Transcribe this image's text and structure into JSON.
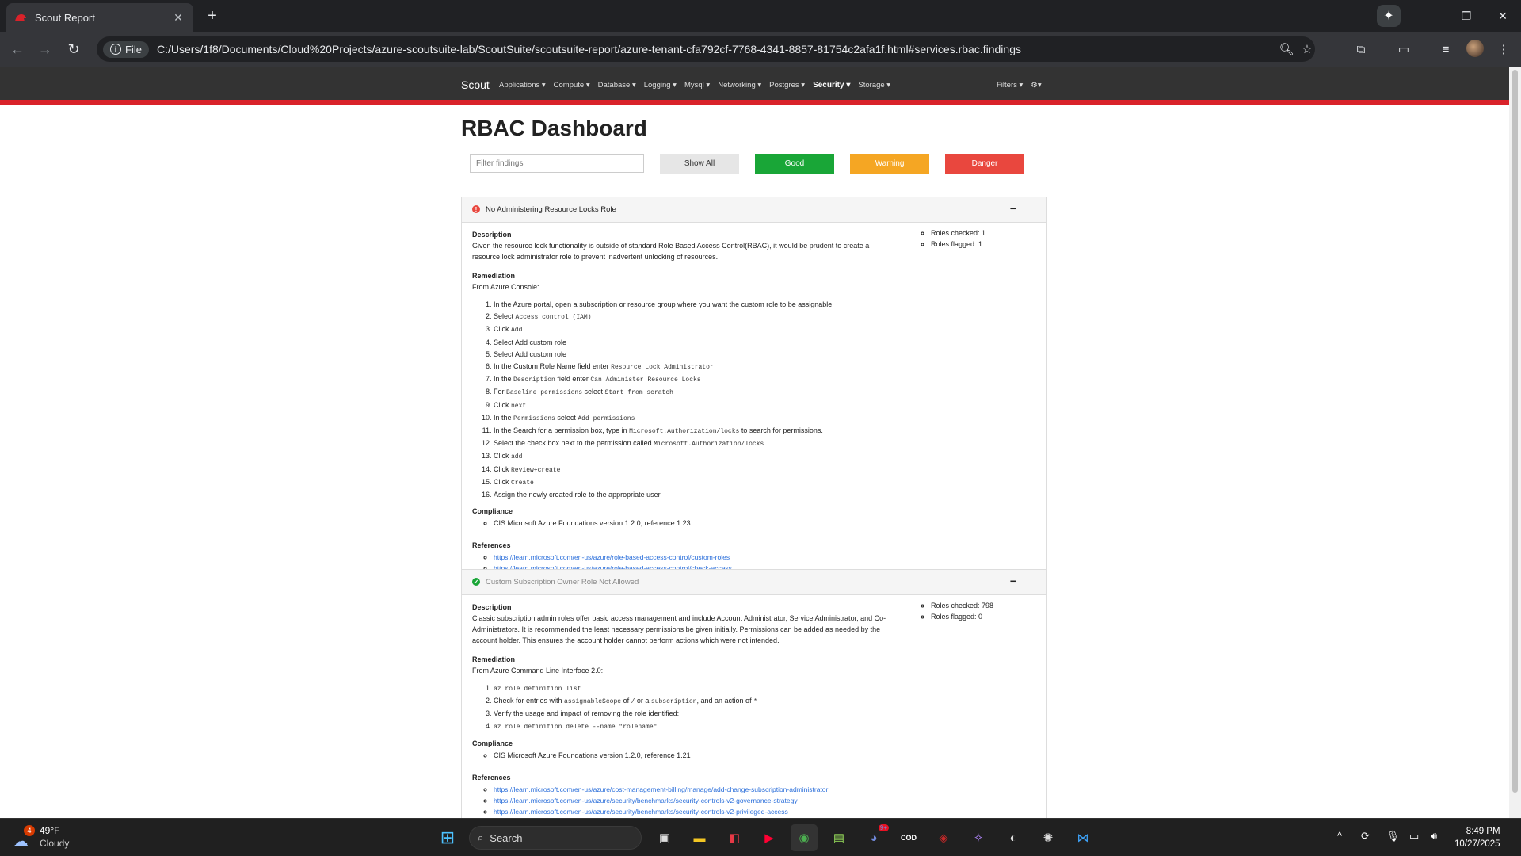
{
  "browser": {
    "tab_title": "Scout Report",
    "new_tab": "+",
    "file_chip": "File",
    "url": "C:/Users/1f8/Documents/Cloud%20Projects/azure-scoutsuite-lab/ScoutSuite/scoutsuite-report/azure-tenant-cfa792cf-7768-4341-8857-81754c2afa1f.html#services.rbac.findings"
  },
  "scout_nav": {
    "brand": "Scout",
    "menu": [
      "Applications",
      "Compute",
      "Database",
      "Logging",
      "Mysql",
      "Networking",
      "Postgres",
      "Security",
      "Storage"
    ],
    "active": "Security",
    "filters": "Filters"
  },
  "page": {
    "title": "RBAC Dashboard",
    "filter_placeholder": "Filter findings",
    "buttons": {
      "show_all": "Show All",
      "good": "Good",
      "warning": "Warning",
      "danger": "Danger"
    }
  },
  "findings": [
    {
      "title": "No Administering Resource Locks Role",
      "status": "danger",
      "collapse": "−",
      "description_label": "Description",
      "description": "Given the resource lock functionality is outside of standard Role Based Access Control(RBAC), it would be prudent to create a resource lock administrator role to prevent inadvertent unlocking of resources.",
      "stats": [
        "Roles checked: 1",
        "Roles flagged: 1"
      ],
      "remediation_label": "Remediation",
      "remediation_intro": "From Azure Console:",
      "steps": [
        [
          {
            "t": "In the Azure portal, open a subscription or resource group where you want the custom role to be assignable."
          }
        ],
        [
          {
            "t": "Select "
          },
          {
            "c": "Access control (IAM)"
          }
        ],
        [
          {
            "t": "Click "
          },
          {
            "c": "Add"
          }
        ],
        [
          {
            "t": "Select Add custom role"
          }
        ],
        [
          {
            "t": "Select Add custom role"
          }
        ],
        [
          {
            "t": "In the Custom Role Name field enter "
          },
          {
            "c": "Resource Lock Administrator"
          }
        ],
        [
          {
            "t": "In the "
          },
          {
            "c": "Description"
          },
          {
            "t": " field enter "
          },
          {
            "c": "Can Administer Resource Locks"
          }
        ],
        [
          {
            "t": "For "
          },
          {
            "c": "Baseline permissions"
          },
          {
            "t": " select "
          },
          {
            "c": "Start from scratch"
          }
        ],
        [
          {
            "t": "Click "
          },
          {
            "c": "next"
          }
        ],
        [
          {
            "t": "In the "
          },
          {
            "c": "Permissions"
          },
          {
            "t": " select "
          },
          {
            "c": "Add permissions"
          }
        ],
        [
          {
            "t": "In the Search for a permission box, type in "
          },
          {
            "c": "Microsoft.Authorization/locks"
          },
          {
            "t": " to search for permissions."
          }
        ],
        [
          {
            "t": "Select the check box next to the permission called "
          },
          {
            "c": "Microsoft.Authorization/locks"
          }
        ],
        [
          {
            "t": "Click "
          },
          {
            "c": "add"
          }
        ],
        [
          {
            "t": "Click "
          },
          {
            "c": "Review+create"
          }
        ],
        [
          {
            "t": "Click "
          },
          {
            "c": "Create"
          }
        ],
        [
          {
            "t": "Assign the newly created role to the appropriate user"
          }
        ]
      ],
      "compliance_label": "Compliance",
      "compliance": [
        "CIS Microsoft Azure Foundations version 1.2.0, reference 1.23"
      ],
      "references_label": "References",
      "references": [
        "https://learn.microsoft.com/en-us/azure/role-based-access-control/custom-roles",
        "https://learn.microsoft.com/en-us/azure/role-based-access-control/check-access"
      ]
    },
    {
      "title": "Custom Subscription Owner Role Not Allowed",
      "status": "good",
      "collapse": "−",
      "description_label": "Description",
      "description": "Classic subscription admin roles offer basic access management and include Account Administrator, Service Administrator, and Co-Administrators. It is recommended the least necessary permissions be given initially. Permissions can be added as needed by the account holder. This ensures the account holder cannot perform actions which were not intended.",
      "stats": [
        "Roles checked: 798",
        "Roles flagged: 0"
      ],
      "remediation_label": "Remediation",
      "remediation_intro": "From Azure Command Line Interface 2.0:",
      "steps": [
        [
          {
            "c": "az role definition list"
          }
        ],
        [
          {
            "t": "Check for entries with "
          },
          {
            "c": "assignableScope"
          },
          {
            "t": " of "
          },
          {
            "c": "/"
          },
          {
            "t": " or a "
          },
          {
            "c": "subscription"
          },
          {
            "t": ", and an action of "
          },
          {
            "c": "*"
          }
        ],
        [
          {
            "t": "Verify the usage and impact of removing the role identified:"
          }
        ],
        [
          {
            "c": "az role definition delete --name \"rolename\""
          }
        ]
      ],
      "compliance_label": "Compliance",
      "compliance": [
        "CIS Microsoft Azure Foundations version 1.2.0, reference 1.21"
      ],
      "references_label": "References",
      "references": [
        "https://learn.microsoft.com/en-us/azure/cost-management-billing/manage/add-change-subscription-administrator",
        "https://learn.microsoft.com/en-us/azure/security/benchmarks/security-controls-v2-governance-strategy",
        "https://learn.microsoft.com/en-us/azure/security/benchmarks/security-controls-v2-privileged-access"
      ]
    }
  ],
  "taskbar": {
    "weather_temp": "49°F",
    "weather_cond": "Cloudy",
    "weather_badge": "4",
    "search_label": "Search",
    "discord_badge": "9+",
    "time": "8:49 PM",
    "date": "10/27/2025"
  },
  "colors": {
    "scout_red": "#d9222a",
    "good": "#19a637",
    "warning": "#f5a623",
    "danger": "#e9473e",
    "link": "#2a6eda"
  }
}
